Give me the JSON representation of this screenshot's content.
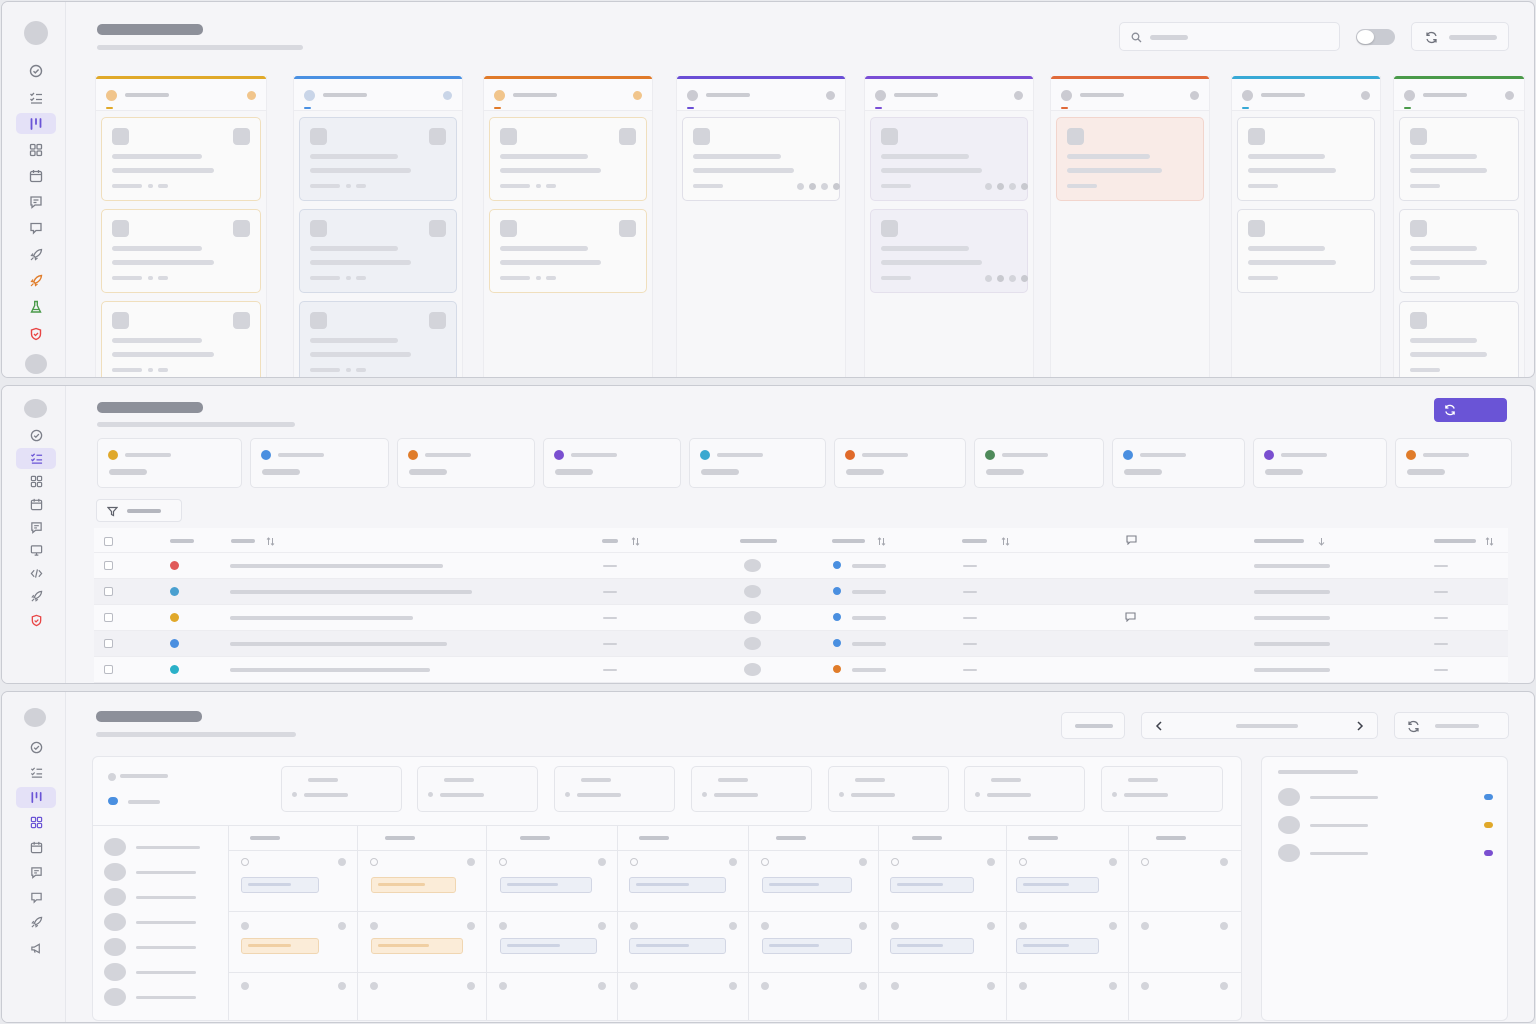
{
  "theme": {
    "accent": "#6a54d6",
    "status_colors": [
      "#e0a82a",
      "#4a8fe0",
      "#e07c2a",
      "#7a4fd0",
      "#3aa8d0",
      "#e06a2a",
      "#4e8a5a",
      "#e84545"
    ],
    "kanban_stripes": [
      "#e0a92a",
      "#4a90e2",
      "#e07a2a",
      "#6a4ed6",
      "#7a4ed6",
      "#e06a3a",
      "#38a9d6",
      "#4a9a4a"
    ]
  },
  "board_view": {
    "sidebar_icons": [
      "dashboard-icon",
      "list-check-icon",
      "kanban-icon",
      "grid-icon",
      "calendar-icon",
      "message-icon",
      "chat-icon",
      "rocket-icon",
      "rocket-orange-icon",
      "flask-icon",
      "shield-red-icon",
      "avatar"
    ],
    "active_nav": "kanban-icon",
    "search_placeholder": "",
    "toggle_on": false,
    "refresh_label": "",
    "columns": [
      {
        "cards": 3
      },
      {
        "cards": 3
      },
      {
        "cards": 2
      },
      {
        "cards": 1
      },
      {
        "cards": 2
      },
      {
        "cards": 1
      },
      {
        "cards": 2
      },
      {
        "cards": 3
      }
    ]
  },
  "list_view": {
    "sidebar_icons": [
      "avatar",
      "dashboard-icon",
      "list-check-icon",
      "grid-icon",
      "calendar-icon",
      "message-icon",
      "monitor-icon",
      "code-icon",
      "rocket-icon",
      "shield-red-icon"
    ],
    "active_nav": "list-check-icon",
    "refresh_label": "",
    "filter_label": "",
    "stat_cards": 10,
    "rows": [
      {
        "status_color": "#e05a5a",
        "assignee_color": "#4a8fe0",
        "has_comment": false
      },
      {
        "status_color": "#4aa0d0",
        "assignee_color": "#4a8fe0",
        "has_comment": false
      },
      {
        "status_color": "#e0a82a",
        "assignee_color": "#4a8fe0",
        "has_comment": true
      },
      {
        "status_color": "#4a8fe0",
        "assignee_color": "#4a8fe0",
        "has_comment": false
      },
      {
        "status_color": "#2ab0c8",
        "assignee_color": "#e07c2a",
        "has_comment": false
      }
    ]
  },
  "schedule_view": {
    "sidebar_icons": [
      "avatar",
      "dashboard-icon",
      "list-check-icon",
      "kanban-icon",
      "grid-icon",
      "calendar-icon",
      "message-icon",
      "chat-icon",
      "rocket-icon",
      "megaphone-icon"
    ],
    "active_nav": "kanban-icon",
    "today_label": "",
    "range_label": "",
    "refresh_label": "",
    "day_columns": 8,
    "people": 7,
    "legend_colors": [
      "#4a8fe0",
      "#e0a82a",
      "#7a4fd0"
    ]
  }
}
